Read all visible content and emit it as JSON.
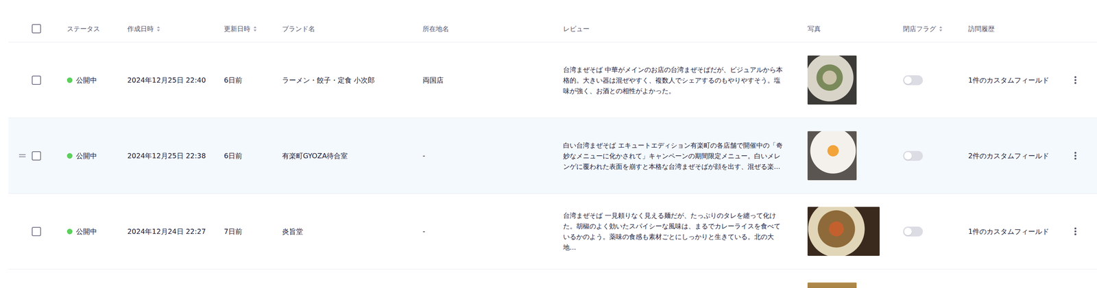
{
  "table": {
    "select_all": {
      "checked": false
    },
    "columns": [
      {
        "label": "ステータス",
        "sortable": false
      },
      {
        "label": "作成日時",
        "sortable": true
      },
      {
        "label": "更新日時",
        "sortable": true
      },
      {
        "label": "ブランド名",
        "sortable": false
      },
      {
        "label": "所在地名",
        "sortable": false
      },
      {
        "label": "レビュー",
        "sortable": false
      },
      {
        "label": "写真",
        "sortable": false
      },
      {
        "label": "閉店フラグ",
        "sortable": true
      },
      {
        "label": "訪問履歴",
        "sortable": false
      }
    ],
    "rows": [
      {
        "highlighted": false,
        "checked": false,
        "status": {
          "label": "公開中",
          "color": "#5ccf5c"
        },
        "created": "2024年12月25日 22:40",
        "updated": "6日前",
        "brand": "ラーメン・餃子・定食 小次郎",
        "location": "両国店",
        "review": "台湾まぜそば 中華がメインのお店の台湾まぜそばだが、ビジュアルから本格的。大きい器は混ぜやすく、複数人でシェアするのもやりやすそう。塩味が強く、お酒との相性がよかった。",
        "photo": {
          "aspect": 1
        },
        "closed": false,
        "visits": "1件のカスタムフィールド"
      },
      {
        "highlighted": true,
        "checked": false,
        "status": {
          "label": "公開中",
          "color": "#5ccf5c"
        },
        "created": "2024年12月25日 22:38",
        "updated": "6日前",
        "brand": "有楽町GYOZA待合室",
        "location": "-",
        "review": "白い台湾まぜそば エキュートエディション有楽町の各店舗で開催中の「奇妙なメニューに化かされて」キャンペーンの期間限定メニュー。白いメレンゲに覆われた表面を崩すと本格な台湾まぜそばが顔を出す、混ぜる楽...",
        "photo": {
          "aspect": 1
        },
        "closed": false,
        "visits": "2件のカスタムフィールド"
      },
      {
        "highlighted": false,
        "checked": false,
        "status": {
          "label": "公開中",
          "color": "#5ccf5c"
        },
        "created": "2024年12月24日 22:27",
        "updated": "7日前",
        "brand": "炎旨堂",
        "location": "-",
        "review": "台湾まぜそば 一見頼りなく見える麺だが、たっぷりのタレを纏って化けた。胡椒のよく効いたスパイシーな風味は、まるでカレーライスを食べているかのよう。薬味の食感も素材ごとにしっかりと生きている。北の大地...",
        "photo": {
          "aspect": 1.47
        },
        "closed": false,
        "visits": "1件のカスタムフィールド"
      },
      {
        "photo": {
          "aspect": 1
        }
      }
    ]
  }
}
